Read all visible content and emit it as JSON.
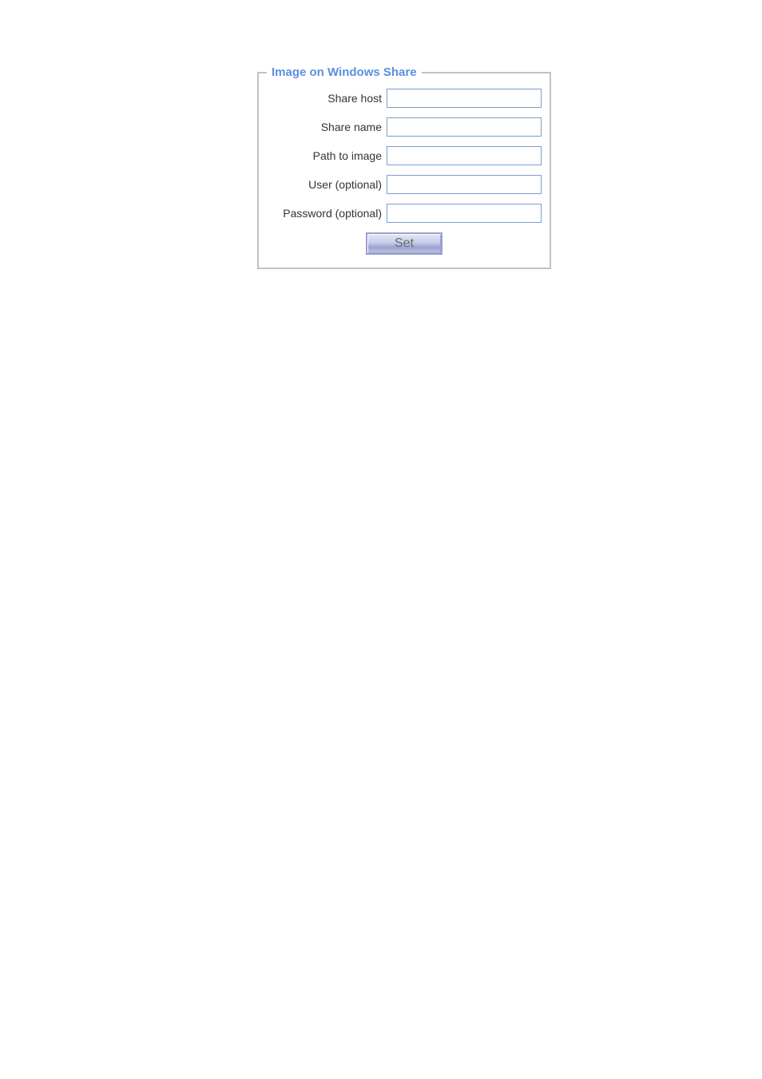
{
  "panel": {
    "legend": "Image on Windows Share",
    "fields": {
      "share_host": {
        "label": "Share host",
        "value": ""
      },
      "share_name": {
        "label": "Share name",
        "value": ""
      },
      "path_to_image": {
        "label": "Path to image",
        "value": ""
      },
      "user": {
        "label": "User (optional)",
        "value": ""
      },
      "password": {
        "label": "Password (optional)",
        "value": ""
      }
    },
    "set_button_label": "Set"
  }
}
